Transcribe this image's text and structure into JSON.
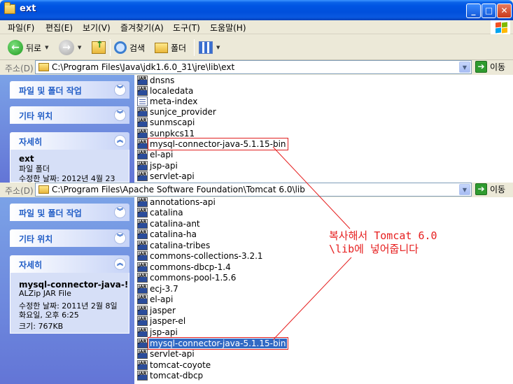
{
  "window": {
    "title": "ext",
    "buttons": {
      "minimize": "_",
      "maximize": "□",
      "close": "✕"
    }
  },
  "menu": [
    {
      "label": "파일(F)"
    },
    {
      "label": "편집(E)"
    },
    {
      "label": "보기(V)"
    },
    {
      "label": "즐겨찾기(A)"
    },
    {
      "label": "도구(T)"
    },
    {
      "label": "도움말(H)"
    }
  ],
  "toolbar": {
    "back_label": "뒤로",
    "search_label": "검색",
    "folders_label": "폴더"
  },
  "pane_top": {
    "address": {
      "label": "주소(D)",
      "path": "C:\\Program Files\\Java\\jdk1.6.0_31\\jre\\lib\\ext",
      "go_label": "이동"
    },
    "tasks": {
      "file_folder_tasks": "파일 및 폴더 작업",
      "other_places": "기타 위치",
      "details": "자세히",
      "detail_name": "ext",
      "detail_type": "파일 폴더",
      "detail_modified": "수정한 날짜: 2012년 4월 23"
    },
    "files": [
      {
        "name": "dnsns",
        "icon": "jar-icon"
      },
      {
        "name": "localedata",
        "icon": "jar-icon"
      },
      {
        "name": "meta-index",
        "icon": "document-icon"
      },
      {
        "name": "sunjce_provider",
        "icon": "jar-icon"
      },
      {
        "name": "sunmscapi",
        "icon": "jar-icon"
      },
      {
        "name": "sunpkcs11",
        "icon": "jar-icon"
      },
      {
        "name": "mysql-connector-java-5.1.15-bin",
        "icon": "jar-icon"
      },
      {
        "name": "el-api",
        "icon": "jar-icon"
      },
      {
        "name": "jsp-api",
        "icon": "jar-icon"
      },
      {
        "name": "servlet-api",
        "icon": "jar-icon"
      }
    ]
  },
  "pane_bottom": {
    "address": {
      "label": "주소(D)",
      "path": "C:\\Program Files\\Apache Software Foundation\\Tomcat 6.0\\lib",
      "go_label": "이동"
    },
    "tasks": {
      "file_folder_tasks": "파일 및 폴더 작업",
      "other_places": "기타 위치",
      "details": "자세히",
      "detail_name": "mysql-connector-java-!",
      "detail_type": "ALZip JAR File",
      "detail_modified": "수정한 날짜: 2011년 2월 8일",
      "detail_time": "화요일, 오후 6:25",
      "detail_size": "크기: 767KB"
    },
    "files": [
      {
        "name": "annotations-api",
        "icon": "jar-icon"
      },
      {
        "name": "catalina",
        "icon": "jar-icon"
      },
      {
        "name": "catalina-ant",
        "icon": "jar-icon"
      },
      {
        "name": "catalina-ha",
        "icon": "jar-icon"
      },
      {
        "name": "catalina-tribes",
        "icon": "jar-icon"
      },
      {
        "name": "commons-collections-3.2.1",
        "icon": "jar-icon"
      },
      {
        "name": "commons-dbcp-1.4",
        "icon": "jar-icon"
      },
      {
        "name": "commons-pool-1.5.6",
        "icon": "jar-icon"
      },
      {
        "name": "ecj-3.7",
        "icon": "jar-icon"
      },
      {
        "name": "el-api",
        "icon": "jar-icon"
      },
      {
        "name": "jasper",
        "icon": "jar-icon"
      },
      {
        "name": "jasper-el",
        "icon": "jar-icon"
      },
      {
        "name": "jsp-api",
        "icon": "jar-icon"
      },
      {
        "name": "mysql-connector-java-5.1.15-bin",
        "icon": "jar-icon"
      },
      {
        "name": "servlet-api",
        "icon": "jar-icon"
      },
      {
        "name": "tomcat-coyote",
        "icon": "jar-icon"
      },
      {
        "name": "tomcat-dbcp",
        "icon": "jar-icon"
      }
    ]
  },
  "annotation": {
    "line1": "복사해서 Tomcat 6.0",
    "line2": "\\lib에 넣어줍니다",
    "color": "#e61e1e"
  },
  "colors": {
    "titlebar": "#0054e3",
    "taskpane": "#6375d6",
    "selection": "#316ac5"
  }
}
